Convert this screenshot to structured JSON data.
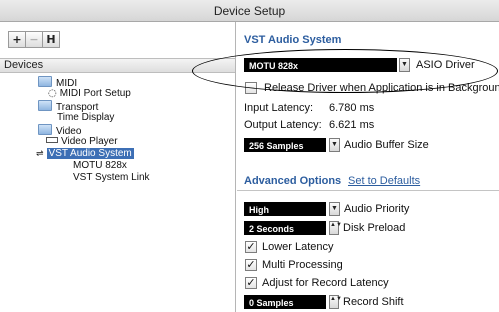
{
  "window": {
    "title": "Device Setup"
  },
  "toolbar": {
    "add": "+",
    "remove": "−",
    "reset": "H"
  },
  "devices": {
    "header": "Devices",
    "items": [
      {
        "label": "MIDI"
      },
      {
        "label": "MIDI Port Setup"
      },
      {
        "label": "Transport"
      },
      {
        "label": "Time Display"
      },
      {
        "label": "Video"
      },
      {
        "label": "Video Player"
      },
      {
        "label": "VST Audio System"
      },
      {
        "label": "MOTU 828x"
      },
      {
        "label": "VST System Link"
      }
    ]
  },
  "panel": {
    "title": "VST Audio System",
    "driver_value": "MOTU 828x",
    "driver_label": "ASIO Driver",
    "release_driver_label": "Release Driver when Application is in Background",
    "release_driver_checked": false,
    "input_latency_label": "Input Latency:",
    "input_latency_value": "6.780 ms",
    "output_latency_label": "Output Latency:",
    "output_latency_value": "6.621 ms",
    "buffer_value": "256 Samples",
    "buffer_label": "Audio Buffer Size",
    "advanced_tab": "Advanced Options",
    "defaults_link": "Set to Defaults",
    "priority_value": "High",
    "priority_label": "Audio Priority",
    "preload_value": "2 Seconds",
    "preload_label": "Disk Preload",
    "lower_latency_label": "Lower Latency",
    "lower_latency_checked": true,
    "multi_processing_label": "Multi Processing",
    "multi_processing_checked": true,
    "record_latency_label": "Adjust for Record Latency",
    "record_latency_checked": true,
    "record_shift_value": "0 Samples",
    "record_shift_label": "Record Shift"
  },
  "glyphs": {
    "check": "✓",
    "dropdown": "▼",
    "step": "▲▼"
  }
}
